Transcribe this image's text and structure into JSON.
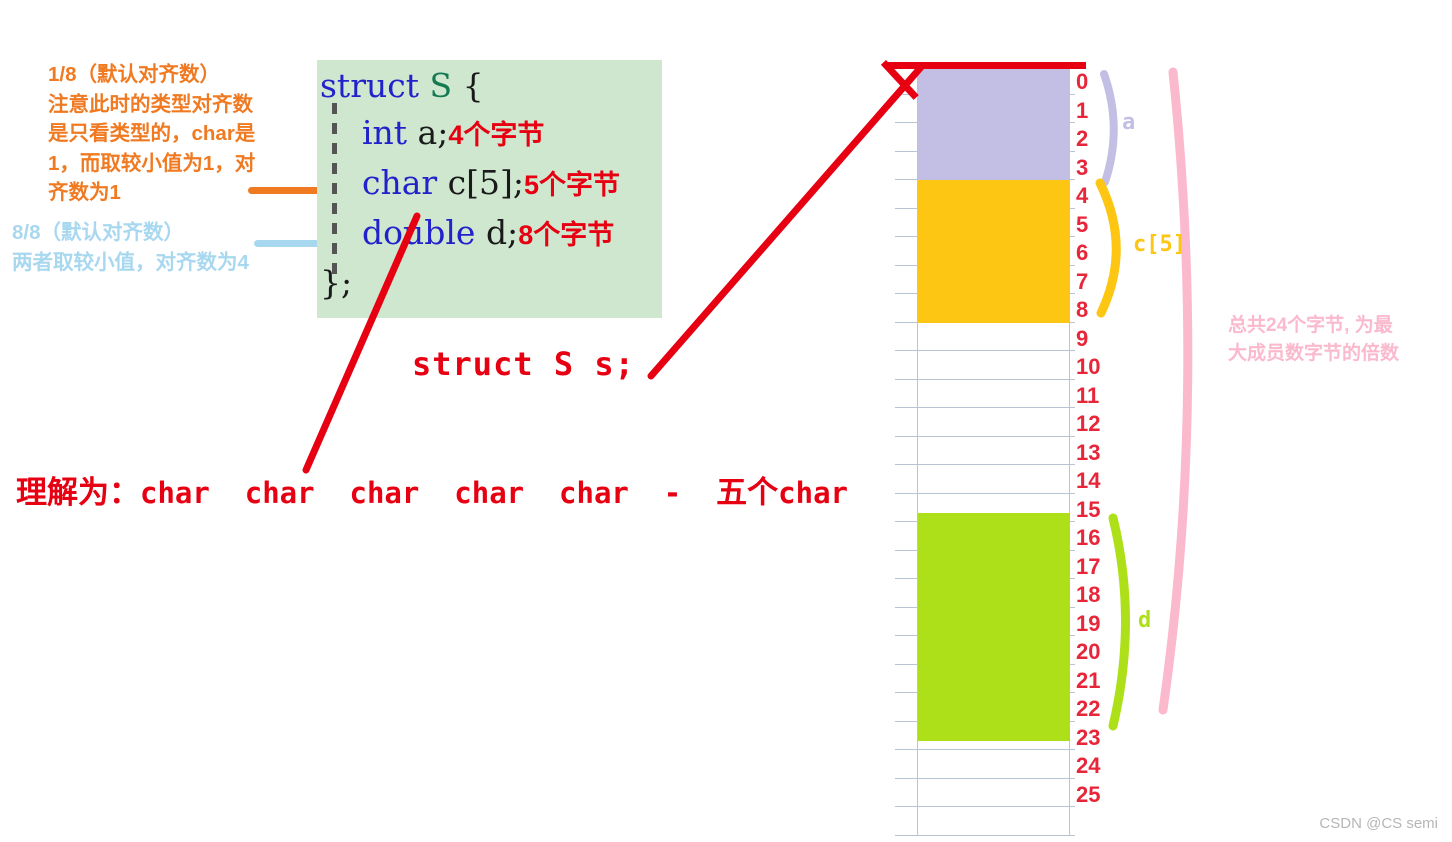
{
  "notes": {
    "orange_note": "1/8（默认对齐数）\n注意此时的类型对齐数\n是只看类型的，char是\n1，而取较小值为1，对\n齐数为1",
    "blue_note_line1": "8/8（默认对齐数）",
    "blue_note_line2": "两者取较小值，对齐数为4",
    "orange_color": "#f07a22",
    "blue_color": "#a8d8ef"
  },
  "code": {
    "background": "#cfe7cf",
    "lines": [
      {
        "text": "struct S {",
        "comment": ""
      },
      {
        "text": "    int a;",
        "comment": "4个字节"
      },
      {
        "text": "    char c[5];",
        "comment": "5个字节"
      },
      {
        "text": "    double d;",
        "comment": "8个字节"
      },
      {
        "text": "};",
        "comment": ""
      }
    ],
    "kw_color": "#2222cc",
    "comment_color": "#e60012"
  },
  "declaration": "struct S s;",
  "bottom_note": {
    "prefix": "理解为：",
    "mono": "char  char  char  char  char  -  ",
    "suffix": "五个",
    "mono_tail": "char",
    "color": "#e60012"
  },
  "memory": {
    "byte_indices": [
      "0",
      "1",
      "2",
      "3",
      "4",
      "5",
      "6",
      "7",
      "8",
      "9",
      "10",
      "11",
      "12",
      "13",
      "14",
      "15",
      "16",
      "17",
      "18",
      "19",
      "20",
      "21",
      "22",
      "23",
      "24",
      "25"
    ],
    "index_color": "#e8263a",
    "blocks": [
      {
        "member": "a",
        "label": "a",
        "start": 0,
        "end": 3,
        "color": "#c3bfe4"
      },
      {
        "member": "c",
        "label": "c[5]",
        "start": 4,
        "end": 8,
        "color": "#fdc612"
      },
      {
        "member": "d",
        "label": "d",
        "start": 16,
        "end": 23,
        "color": "#aee019"
      }
    ],
    "total_rows": 26
  },
  "total_note": {
    "text": "总共24个字节, 为最大成员数字节的倍数",
    "color": "#fbb9ce"
  },
  "watermark": "CSDN @CS semi"
}
